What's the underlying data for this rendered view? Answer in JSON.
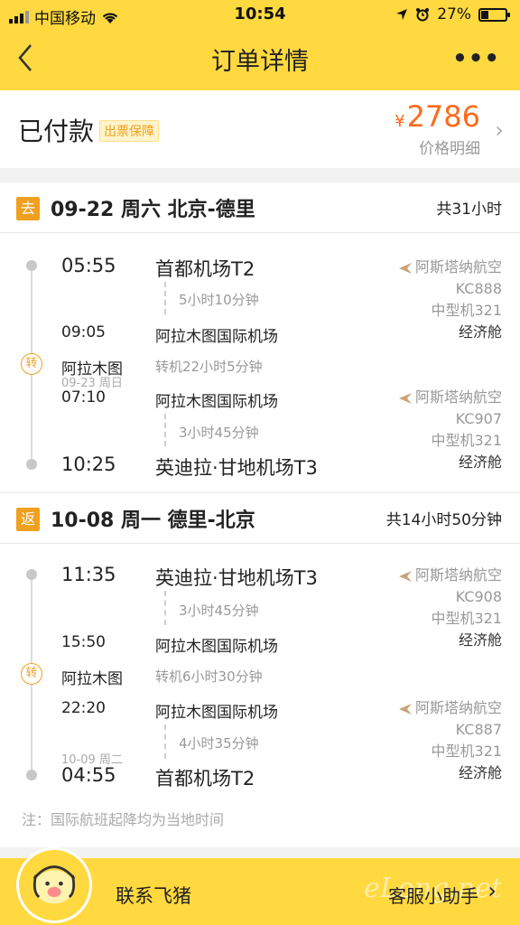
{
  "status_bar": {
    "carrier": "中国移动",
    "time": "10:54",
    "battery": "27%"
  },
  "nav": {
    "title": "订单详情",
    "more": "•••"
  },
  "order": {
    "status": "已付款",
    "badge": "出票保障",
    "currency": "¥",
    "price": "2786",
    "price_detail": "价格明细"
  },
  "outbound": {
    "tag": "去",
    "route": "09-22 周六 北京-德里",
    "total": "共31小时",
    "seg1": {
      "dep_time": "05:55",
      "dep_airport": "首都机场T2",
      "duration": "5小时10分钟",
      "arr_time": "09:05",
      "arr_airport": "阿拉木图国际机场",
      "airline": "阿斯塔纳航空",
      "flight": "KC888",
      "aircraft": "中型机321",
      "cabin": "经济舱"
    },
    "transfer": {
      "icon": "转",
      "city": "阿拉木图",
      "next_date": "09-23 周日",
      "info": "转机22小时5分钟"
    },
    "seg2": {
      "dep_time": "07:10",
      "dep_airport": "阿拉木图国际机场",
      "duration": "3小时45分钟",
      "arr_time": "10:25",
      "arr_airport": "英迪拉·甘地机场T3",
      "airline": "阿斯塔纳航空",
      "flight": "KC907",
      "aircraft": "中型机321",
      "cabin": "经济舱"
    }
  },
  "return": {
    "tag": "返",
    "route": "10-08 周一 德里-北京",
    "total": "共14小时50分钟",
    "seg1": {
      "dep_time": "11:35",
      "dep_airport": "英迪拉·甘地机场T3",
      "duration": "3小时45分钟",
      "arr_time": "15:50",
      "arr_airport": "阿拉木图国际机场",
      "airline": "阿斯塔纳航空",
      "flight": "KC908",
      "aircraft": "中型机321",
      "cabin": "经济舱"
    },
    "transfer": {
      "icon": "转",
      "city": "阿拉木图",
      "info": "转机6小时30分钟"
    },
    "seg2": {
      "dep_time": "22:20",
      "dep_airport": "阿拉木图国际机场",
      "duration": "4小时35分钟",
      "arr_date": "10-09 周二",
      "arr_time": "04:55",
      "arr_airport": "首都机场T2",
      "airline": "阿斯塔纳航空",
      "flight": "KC887",
      "aircraft": "中型机321",
      "cabin": "经济舱"
    }
  },
  "note": "注：国际航班起降均为当地时间",
  "footer": {
    "contact": "联系飞猪",
    "helper": "客服小助手",
    "watermark": "eLong.net"
  },
  "colors": {
    "brand_yellow": "#ffd93f",
    "price_orange": "#ff6a1a",
    "tag_orange": "#f0a020"
  }
}
